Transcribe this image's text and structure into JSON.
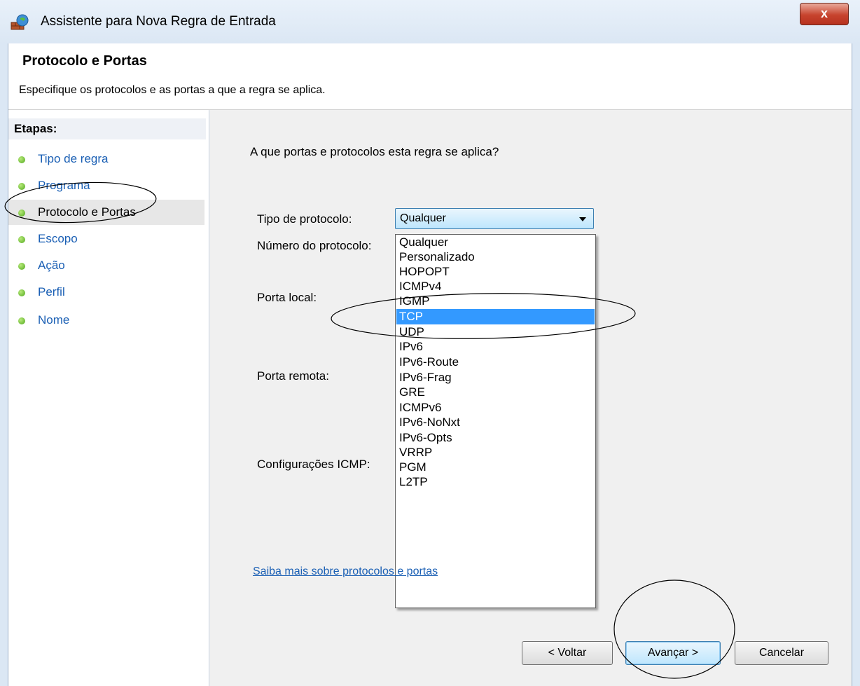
{
  "window": {
    "title": "Assistente para Nova Regra de Entrada",
    "close_label": "x"
  },
  "header": {
    "title": "Protocolo e Portas",
    "subtitle": "Especifique os protocolos e as portas a que a regra se aplica."
  },
  "steps": {
    "heading": "Etapas:",
    "items": [
      {
        "label": "Tipo de regra",
        "active": false
      },
      {
        "label": "Programa",
        "active": false
      },
      {
        "label": "Protocolo e Portas",
        "active": true
      },
      {
        "label": "Escopo",
        "active": false
      },
      {
        "label": "Ação",
        "active": false
      },
      {
        "label": "Perfil",
        "active": false
      },
      {
        "label": "Nome",
        "active": false
      }
    ]
  },
  "main": {
    "question": "A que portas e protocolos esta regra se aplica?",
    "labels": {
      "protocol_type": "Tipo de protocolo:",
      "protocol_number": "Número do protocolo:",
      "local_port": "Porta local:",
      "remote_port": "Porta remota:",
      "icmp_settings": "Configurações ICMP:"
    },
    "protocol_combo": {
      "value": "Qualquer",
      "options": [
        "Qualquer",
        "Personalizado",
        "HOPOPT",
        "ICMPv4",
        "IGMP",
        "TCP",
        "UDP",
        "IPv6",
        "IPv6-Route",
        "IPv6-Frag",
        "GRE",
        "ICMPv6",
        "IPv6-NoNxt",
        "IPv6-Opts",
        "VRRP",
        "PGM",
        "L2TP"
      ],
      "highlighted": "TCP"
    },
    "help_link": "Saiba mais sobre protocolos e portas"
  },
  "buttons": {
    "back": "< Voltar",
    "next": "Avançar >",
    "cancel": "Cancelar"
  },
  "colors": {
    "link": "#1a5fb4",
    "selection": "#3399ff",
    "step_dot": "#4fa71c"
  }
}
